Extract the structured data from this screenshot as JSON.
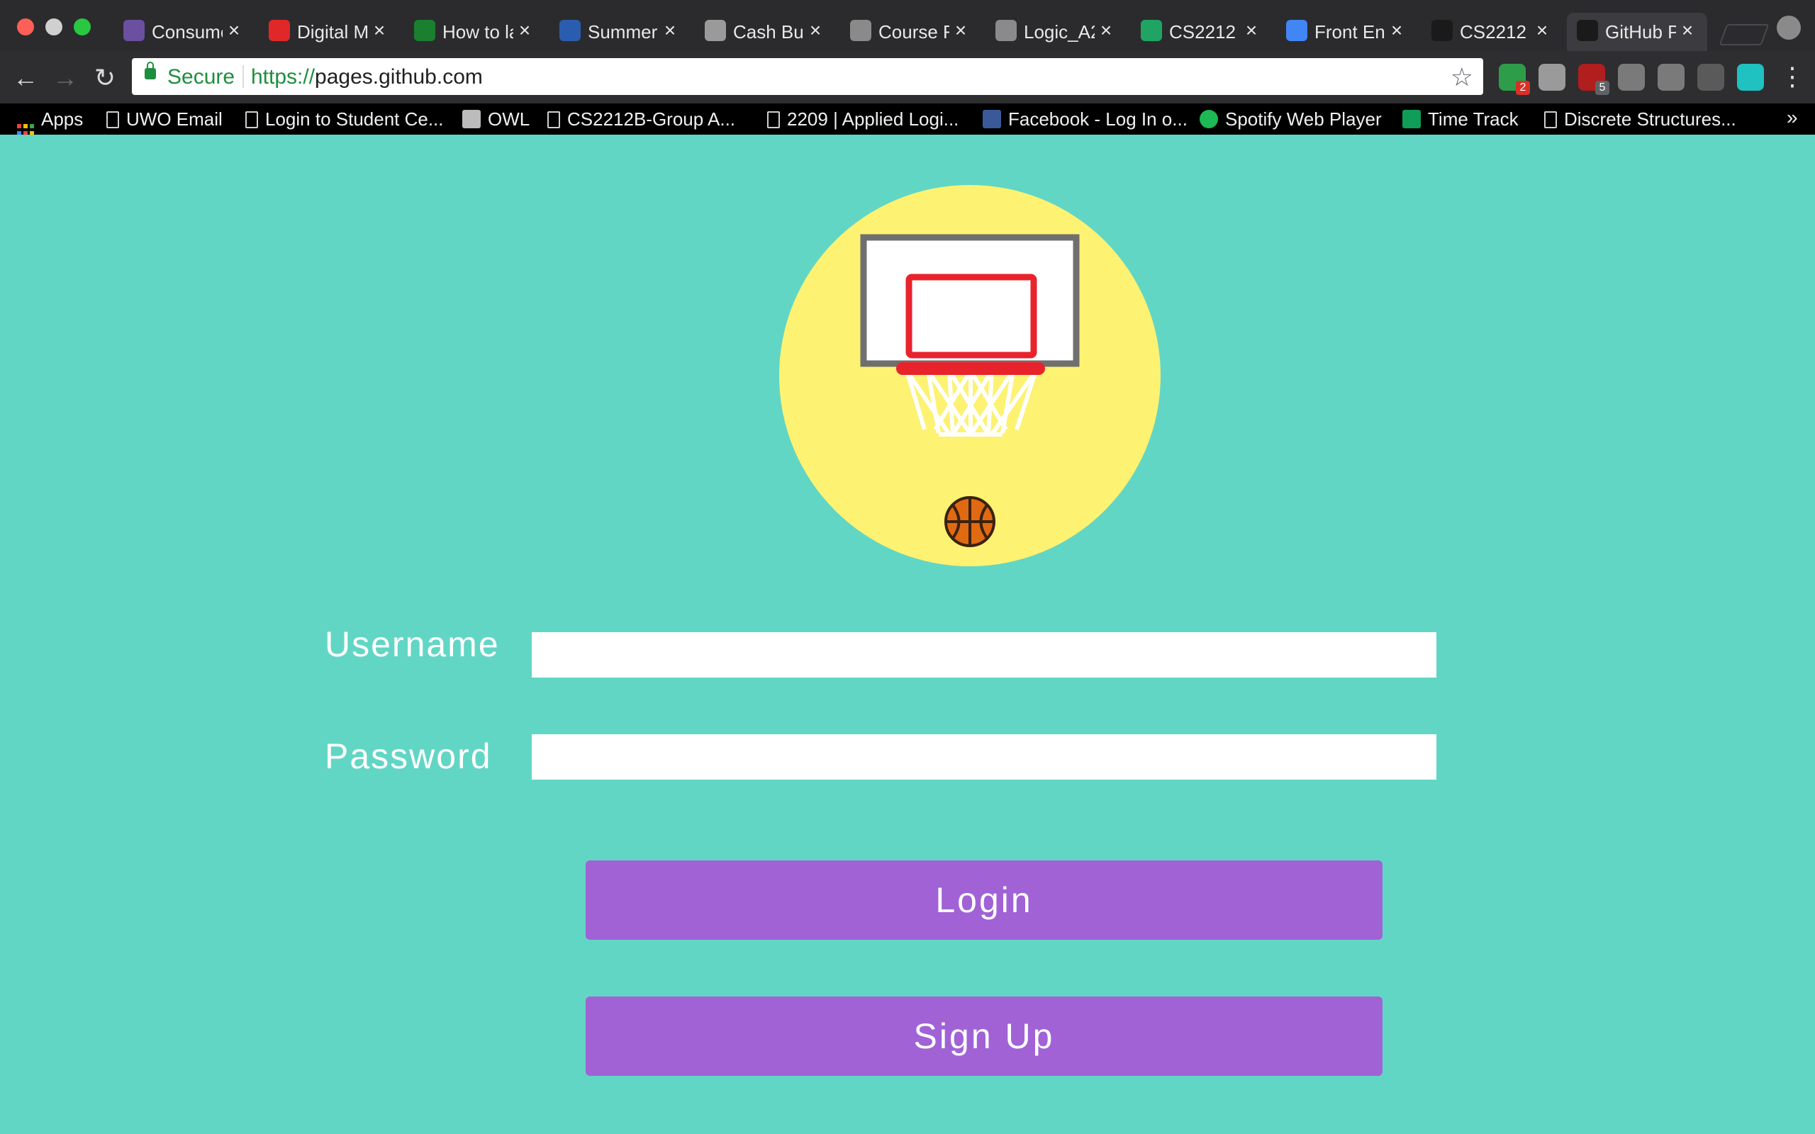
{
  "browser": {
    "tabs": [
      {
        "title": "Consume",
        "favicon_color": "#6b4fa0",
        "icon": "shield-favicon"
      },
      {
        "title": "Digital M",
        "favicon_color": "#e02828",
        "icon": "digital-favicon"
      },
      {
        "title": "How to la",
        "favicon_color": "#1a7f2e",
        "icon": "video-favicon"
      },
      {
        "title": "Summer",
        "favicon_color": "#2a5db0",
        "icon": "bank-favicon"
      },
      {
        "title": "Cash Bu",
        "favicon_color": "#9a9a9a",
        "icon": "mustang-favicon"
      },
      {
        "title": "Course F",
        "favicon_color": "#8a8a8a",
        "icon": "doc-favicon"
      },
      {
        "title": "Logic_A2",
        "favicon_color": "#8a8a8a",
        "icon": "doc-favicon"
      },
      {
        "title": "CS2212",
        "favicon_color": "#1fa463",
        "icon": "drive-favicon"
      },
      {
        "title": "Front En",
        "favicon_color": "#4285f4",
        "icon": "gdocs-favicon"
      },
      {
        "title": "CS2212",
        "favicon_color": "#1a1a1a",
        "icon": "github-favicon"
      },
      {
        "title": "GitHub P",
        "favicon_color": "#1a1a1a",
        "icon": "github-favicon"
      }
    ],
    "tab_close_glyph": "×",
    "omnibox": {
      "secure_label": "Secure",
      "url_scheme": "https://",
      "url_host": "pages.github.com"
    },
    "extensions": [
      {
        "name": "green-extension-icon",
        "color": "#2e9d4a",
        "badge": "2",
        "badge_color": "#d93025"
      },
      {
        "name": "drive-extension-icon",
        "color": "#9a9a9a",
        "badge": ""
      },
      {
        "name": "ublock-extension-icon",
        "color": "#b01e1e",
        "badge": "5",
        "badge_color": "#5f6368"
      },
      {
        "name": "power-extension-icon",
        "color": "#7a7a7a",
        "badge": ""
      },
      {
        "name": "recycle-extension-icon",
        "color": "#7a7a7a",
        "badge": ""
      },
      {
        "name": "color-extension-icon",
        "color": "#5a5a5a",
        "badge": ""
      },
      {
        "name": "m-extension-icon",
        "color": "#1fc1c1",
        "badge": ""
      }
    ],
    "bookmarks": [
      {
        "label": "Apps",
        "icon": "apps-grid-icon"
      },
      {
        "label": "UWO Email",
        "icon": "doc-icon"
      },
      {
        "label": "Login to Student Ce...",
        "icon": "doc-icon"
      },
      {
        "label": "OWL",
        "icon": "mustang-icon"
      },
      {
        "label": "CS2212B-Group A...",
        "icon": "doc-icon"
      },
      {
        "label": "2209 | Applied Logi...",
        "icon": "doc-icon"
      },
      {
        "label": "Facebook - Log In o...",
        "icon": "facebook-icon"
      },
      {
        "label": "Spotify Web Player",
        "icon": "spotify-icon"
      },
      {
        "label": "Time Track",
        "icon": "sheets-icon"
      },
      {
        "label": "Discrete Structures...",
        "icon": "doc-icon"
      }
    ],
    "bookmarks_more": "»"
  },
  "page": {
    "background_color": "#62d6c5",
    "logo": {
      "circle_color": "#fdf272",
      "backboard_frame": "#6f6f6f",
      "rim_color": "#e8232c",
      "ball_color": "#e06a12"
    },
    "username_label": "Username",
    "password_label": "Password",
    "login_button": "Login",
    "signup_button": "Sign Up",
    "button_color": "#a162d6"
  }
}
